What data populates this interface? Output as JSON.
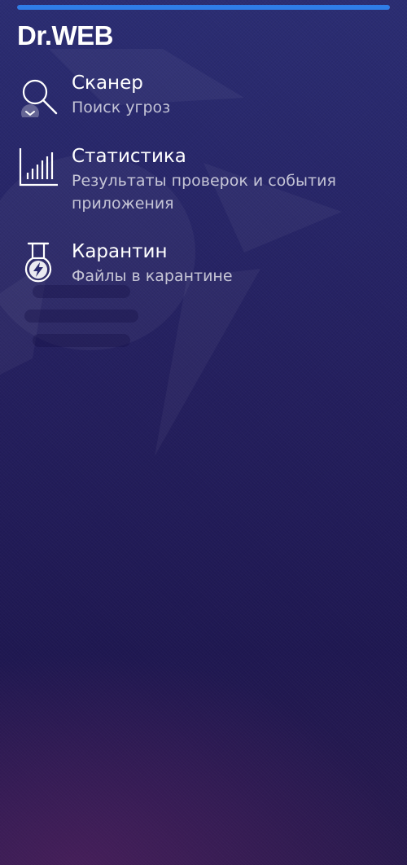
{
  "app": {
    "logo_text": "Dr.WEB",
    "brand_color": "#2f7de8",
    "background_color": "#241f5e"
  },
  "progress": {
    "value": 1.0
  },
  "menu": {
    "items": [
      {
        "id": "scanner",
        "title": "Сканер",
        "subtitle": "Поиск угроз",
        "icon": "magnifier-icon"
      },
      {
        "id": "stats",
        "title": "Статистика",
        "subtitle": "Результаты проверок и события приложения",
        "icon": "bar-chart-icon"
      },
      {
        "id": "quarantine",
        "title": "Карантин",
        "subtitle": "Файлы в карантине",
        "icon": "flask-icon"
      }
    ]
  }
}
